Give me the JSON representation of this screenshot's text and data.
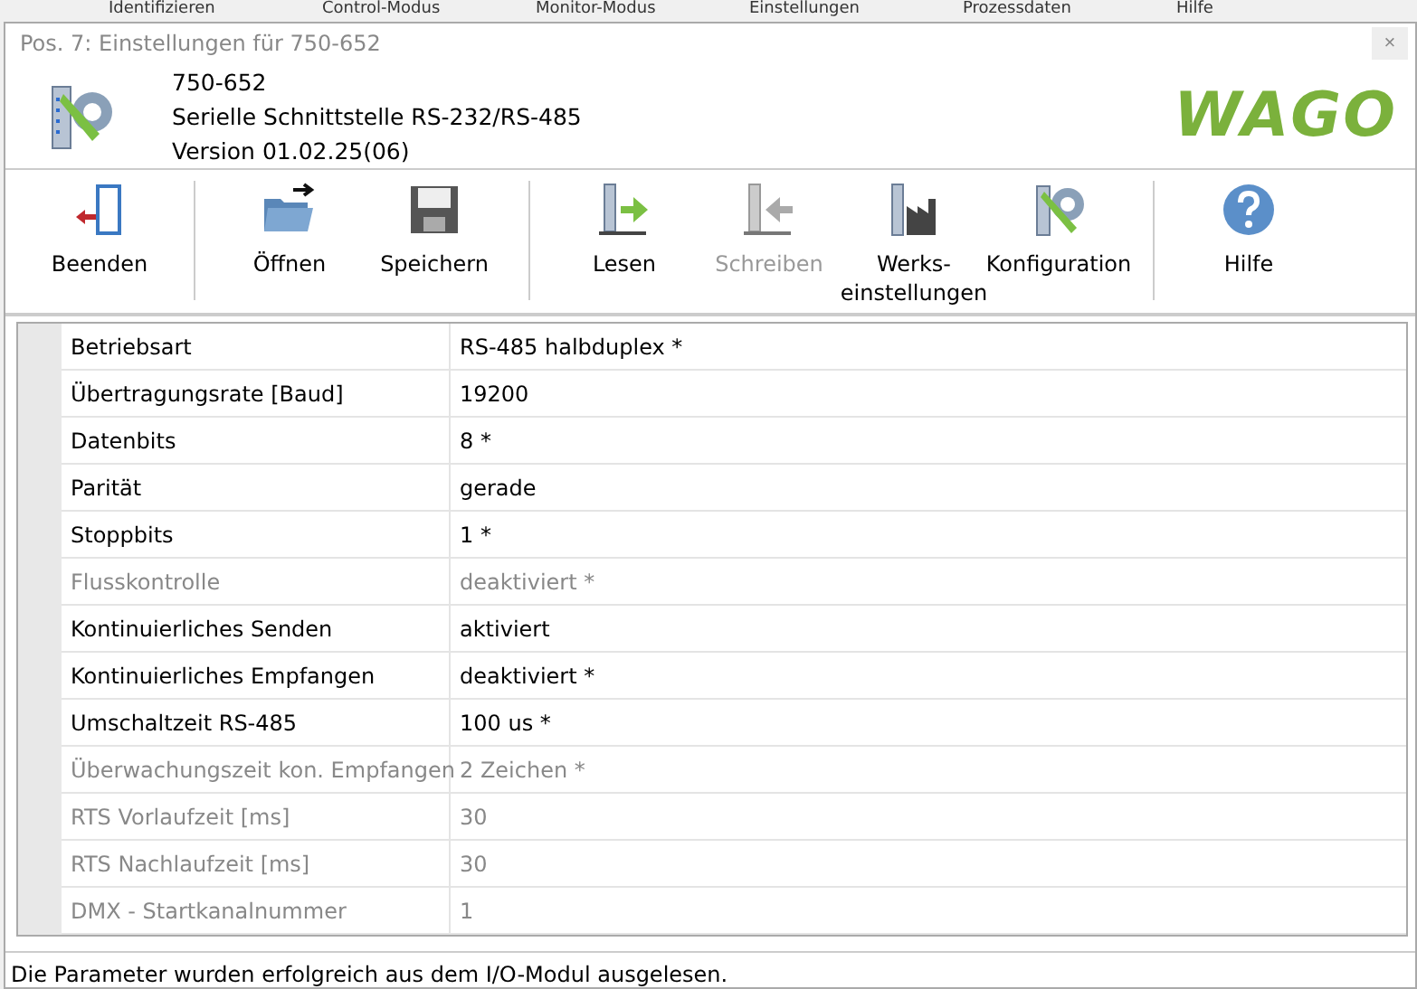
{
  "background_menu": [
    "Identifizieren",
    "Control-Modus",
    "Monitor-Modus",
    "Einstellungen",
    "Prozessdaten",
    "Hilfe"
  ],
  "window": {
    "title": "Pos. 7: Einstellungen für 750-652",
    "close": "×"
  },
  "header": {
    "lines": [
      "750-652",
      "Serielle Schnittstelle RS-232/RS-485",
      "Version 01.02.25(06)"
    ],
    "logo": "WAGO"
  },
  "toolbar": [
    {
      "kind": "button",
      "label": "Beenden",
      "disabled": false
    },
    {
      "kind": "separator"
    },
    {
      "kind": "button",
      "label": "Öffnen",
      "disabled": false
    },
    {
      "kind": "button",
      "label": "Speichern",
      "disabled": false
    },
    {
      "kind": "separator"
    },
    {
      "kind": "button",
      "label": "Lesen",
      "disabled": false
    },
    {
      "kind": "button",
      "label": "Schreiben",
      "disabled": true
    },
    {
      "kind": "button",
      "label": "Werks-\neinstellungen",
      "disabled": false
    },
    {
      "kind": "button",
      "label": "Konfiguration",
      "disabled": false
    },
    {
      "kind": "separator"
    },
    {
      "kind": "button",
      "label": "Hilfe",
      "disabled": false
    }
  ],
  "table": {
    "rows": [
      {
        "label": "Betriebsart",
        "value": "RS-485 halbduplex *",
        "disabled": false
      },
      {
        "label": "Übertragungsrate [Baud]",
        "value": "19200",
        "disabled": false
      },
      {
        "label": "Datenbits",
        "value": "8 *",
        "disabled": false
      },
      {
        "label": "Parität",
        "value": "gerade",
        "disabled": false
      },
      {
        "label": "Stoppbits",
        "value": "1 *",
        "disabled": false
      },
      {
        "label": "Flusskontrolle",
        "value": "deaktiviert *",
        "disabled": true
      },
      {
        "label": "Kontinuierliches Senden",
        "value": "aktiviert",
        "disabled": false
      },
      {
        "label": "Kontinuierliches Empfangen",
        "value": "deaktiviert *",
        "disabled": false
      },
      {
        "label": "Umschaltzeit RS-485",
        "value": "100 us *",
        "disabled": false
      },
      {
        "label": "Überwachungszeit kon. Empfangen",
        "value": "2 Zeichen *",
        "disabled": true
      },
      {
        "label": "RTS Vorlaufzeit [ms]",
        "value": "30",
        "disabled": true
      },
      {
        "label": "RTS Nachlaufzeit [ms]",
        "value": "30",
        "disabled": true
      },
      {
        "label": "DMX - Startkanalnummer",
        "value": "1",
        "disabled": true
      }
    ]
  },
  "status_bar": "Die Parameter wurden erfolgreich aus dem I/O-Modul ausgelesen."
}
